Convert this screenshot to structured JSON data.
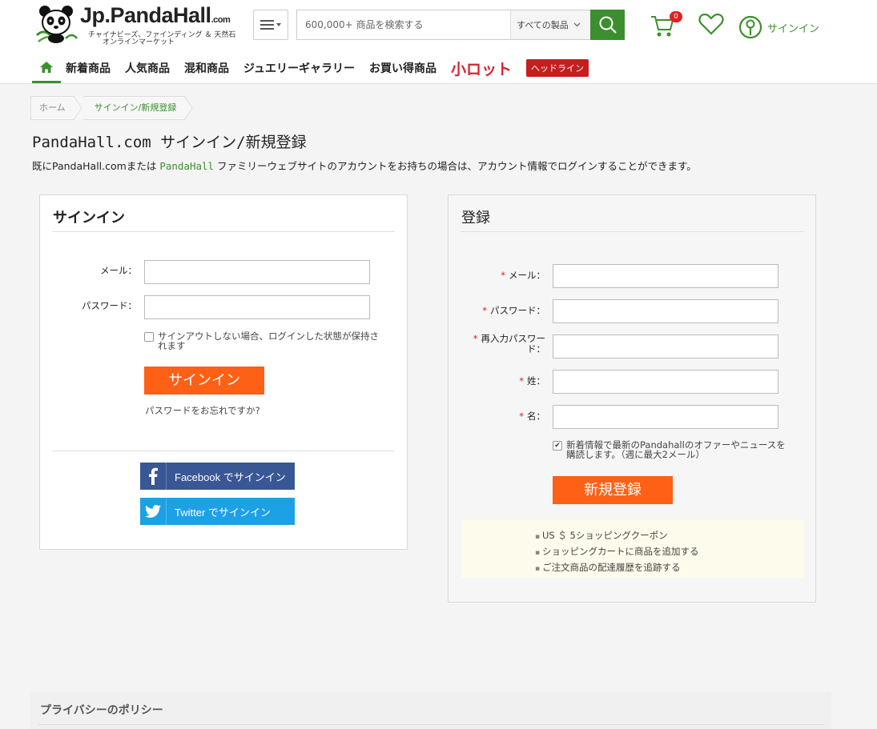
{
  "header": {
    "brand": "Jp.PandaHall",
    "brand_suffix": ".com",
    "tagline1": "チャイナビーズ、ファインディング ＆ 天然石",
    "tagline2": "オンラインマーケット",
    "search_placeholder": "600,000+ 商品を検索する",
    "category": "すべての製品",
    "cart_count": "0",
    "signin": "サインイン",
    "accent_color": "#3c8f2e"
  },
  "nav": {
    "items": [
      "新着商品",
      "人気商品",
      "混和商品",
      "ジュエリーギャラリー",
      "お買い得商品"
    ],
    "lot": "小ロット",
    "headline": "ヘッドライン"
  },
  "breadcrumb": [
    "ホーム",
    "サインイン/新規登録"
  ],
  "page": {
    "title": "PandaHall.com サインイン/新規登録",
    "intro_pre": "既にPandaHall.comまたは ",
    "intro_link": "PandaHall",
    "intro_post": " ファミリーウェブサイトのアカウントをお持ちの場合は、アカウント情報でログインすることができます。"
  },
  "signin": {
    "title": "サインイン",
    "email_label": "メール：",
    "password_label": "パスワード：",
    "remember": "サインアウトしない場合、ログインした状態が保持されます",
    "button": "サインイン",
    "forgot": "パスワードをお忘れですか?",
    "facebook": "Facebook でサインイン",
    "twitter": "Twitter でサインイン"
  },
  "register": {
    "title": "登録",
    "email_label": "メール：",
    "password_label": "パスワード：",
    "confirm_label_1": "再入力パスワー",
    "confirm_label_2": "ド：",
    "last_name_label": "姓：",
    "first_name_label": "名：",
    "newsletter": "新着情報で最新のPandahallのオファーやニュースを購読します。（週に最大2メール）",
    "newsletter_checked": true,
    "button": "新規登録",
    "benefits": [
      "US ＄ 5ショッピングクーポン",
      "ショッピングカートに商品を追加する",
      "ご注文商品の配達履歴を追跡する"
    ]
  },
  "footer": {
    "privacy": "プライバシーのポリシー"
  }
}
